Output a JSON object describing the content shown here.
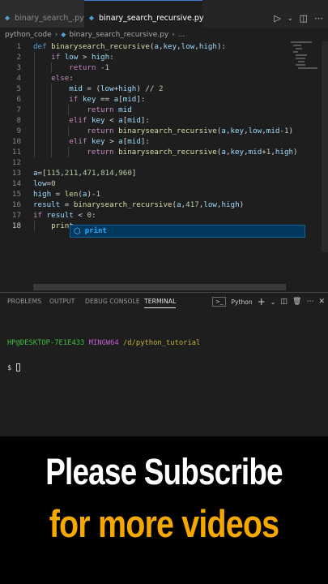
{
  "tabs": [
    {
      "label": "binary_search_.py",
      "icon": "python-file-icon"
    },
    {
      "label": "binary_search_recursive.py",
      "icon": "python-file-icon",
      "modified": true
    }
  ],
  "breadcrumb": {
    "folder": "python_code",
    "file": "binary_search_recursive.py",
    "more": "..."
  },
  "editor": {
    "line_numbers": [
      "1",
      "2",
      "3",
      "4",
      "5",
      "6",
      "7",
      "8",
      "9",
      "10",
      "11",
      "12",
      "13",
      "14",
      "15",
      "16",
      "17",
      "18"
    ],
    "active_line": "18",
    "code": [
      "def binarysearch_recursive(a,key,low,high):",
      "    if low > high:",
      "        return -1",
      "    else:",
      "        mid = (low+high) // 2",
      "        if key == a[mid]:",
      "            return mid",
      "        elif key < a[mid]:",
      "            return binarysearch_recursive(a,key,low,mid-1)",
      "        elif key > a[mid]:",
      "            return binarysearch_recursive(a,key,mid+1,high)",
      "",
      "a=[115,211,471,814,960]",
      "low=0",
      "high = len(a)-1",
      "result = binarysearch_recursive(a,417,low,high)",
      "if result < 0:",
      "    print"
    ],
    "suggestion": {
      "text": "print",
      "icon": "cube-icon"
    }
  },
  "panel": {
    "tabs": [
      "PROBLEMS",
      "OUTPUT",
      "DEBUG CONSOLE",
      "TERMINAL"
    ],
    "active_tab": "TERMINAL",
    "shell": "Python",
    "terminal": {
      "user_host": "HP@DESKTOP-7E1E433",
      "system": "MINGW64",
      "path": "/d/python_tutorial",
      "prompt": "$"
    }
  },
  "banner": {
    "line1": "Please Subscribe",
    "line2": "for more videos",
    "line1_color": "#ffffff",
    "line2_color": "#f5a800"
  }
}
